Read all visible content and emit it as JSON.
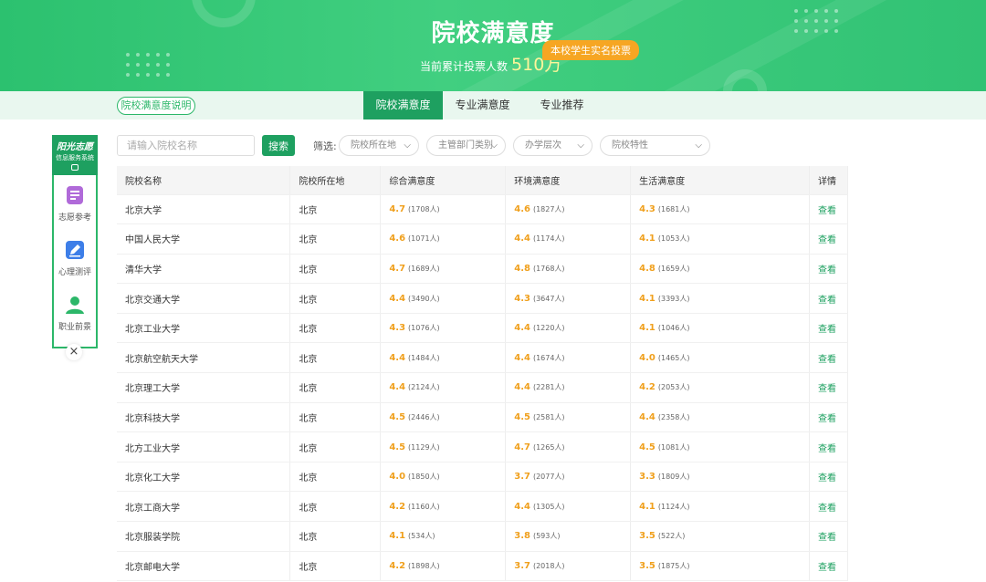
{
  "banner": {
    "title": "院校满意度",
    "sub_label": "当前累计投票人数",
    "sub_number": "510",
    "sub_unit": "万",
    "tag": "本校学生实名投票"
  },
  "tabs": {
    "explain": "院校满意度说明",
    "items": [
      {
        "label": "院校满意度",
        "active": true
      },
      {
        "label": "专业满意度",
        "active": false
      },
      {
        "label": "专业推荐",
        "active": false
      }
    ]
  },
  "side": {
    "head_title": "阳光志愿",
    "head_sub": "信息服务系统",
    "items": [
      {
        "label": "志愿参考",
        "icon": "list-icon"
      },
      {
        "label": "心理测评",
        "icon": "pencil-icon"
      },
      {
        "label": "职业前景",
        "icon": "user-icon"
      }
    ],
    "close": "×"
  },
  "search": {
    "placeholder": "请输入院校名称",
    "button": "搜索",
    "filter_label": "筛选:",
    "selects": [
      "院校所在地",
      "主管部门类别",
      "办学层次",
      "院校特性"
    ]
  },
  "table": {
    "headers": [
      "院校名称",
      "院校所在地",
      "综合满意度",
      "环境满意度",
      "生活满意度",
      "详情"
    ],
    "rows": [
      {
        "name": "北京大学",
        "loc": "北京",
        "s1": "4.7",
        "c1": "(1708人)",
        "s2": "4.6",
        "c2": "(1827人)",
        "s3": "4.3",
        "c3": "(1681人)",
        "view": "查看"
      },
      {
        "name": "中国人民大学",
        "loc": "北京",
        "s1": "4.6",
        "c1": "(1071人)",
        "s2": "4.4",
        "c2": "(1174人)",
        "s3": "4.1",
        "c3": "(1053人)",
        "view": "查看"
      },
      {
        "name": "清华大学",
        "loc": "北京",
        "s1": "4.7",
        "c1": "(1689人)",
        "s2": "4.8",
        "c2": "(1768人)",
        "s3": "4.8",
        "c3": "(1659人)",
        "view": "查看"
      },
      {
        "name": "北京交通大学",
        "loc": "北京",
        "s1": "4.4",
        "c1": "(3490人)",
        "s2": "4.3",
        "c2": "(3647人)",
        "s3": "4.1",
        "c3": "(3393人)",
        "view": "查看"
      },
      {
        "name": "北京工业大学",
        "loc": "北京",
        "s1": "4.3",
        "c1": "(1076人)",
        "s2": "4.4",
        "c2": "(1220人)",
        "s3": "4.1",
        "c3": "(1046人)",
        "view": "查看"
      },
      {
        "name": "北京航空航天大学",
        "loc": "北京",
        "s1": "4.4",
        "c1": "(1484人)",
        "s2": "4.4",
        "c2": "(1674人)",
        "s3": "4.0",
        "c3": "(1465人)",
        "view": "查看"
      },
      {
        "name": "北京理工大学",
        "loc": "北京",
        "s1": "4.4",
        "c1": "(2124人)",
        "s2": "4.4",
        "c2": "(2281人)",
        "s3": "4.2",
        "c3": "(2053人)",
        "view": "查看"
      },
      {
        "name": "北京科技大学",
        "loc": "北京",
        "s1": "4.5",
        "c1": "(2446人)",
        "s2": "4.5",
        "c2": "(2581人)",
        "s3": "4.4",
        "c3": "(2358人)",
        "view": "查看"
      },
      {
        "name": "北方工业大学",
        "loc": "北京",
        "s1": "4.5",
        "c1": "(1129人)",
        "s2": "4.7",
        "c2": "(1265人)",
        "s3": "4.5",
        "c3": "(1081人)",
        "view": "查看"
      },
      {
        "name": "北京化工大学",
        "loc": "北京",
        "s1": "4.0",
        "c1": "(1850人)",
        "s2": "3.7",
        "c2": "(2077人)",
        "s3": "3.3",
        "c3": "(1809人)",
        "view": "查看"
      },
      {
        "name": "北京工商大学",
        "loc": "北京",
        "s1": "4.2",
        "c1": "(1160人)",
        "s2": "4.4",
        "c2": "(1305人)",
        "s3": "4.1",
        "c3": "(1124人)",
        "view": "查看"
      },
      {
        "name": "北京服装学院",
        "loc": "北京",
        "s1": "4.1",
        "c1": "(534人)",
        "s2": "3.8",
        "c2": "(593人)",
        "s3": "3.5",
        "c3": "(522人)",
        "view": "查看"
      },
      {
        "name": "北京邮电大学",
        "loc": "北京",
        "s1": "4.2",
        "c1": "(1898人)",
        "s2": "3.7",
        "c2": "(2018人)",
        "s3": "3.5",
        "c3": "(1875人)",
        "view": "查看"
      }
    ]
  },
  "colors": {
    "brand": "#1ea060",
    "score": "#f0a01d",
    "tag": "#f6a623"
  }
}
